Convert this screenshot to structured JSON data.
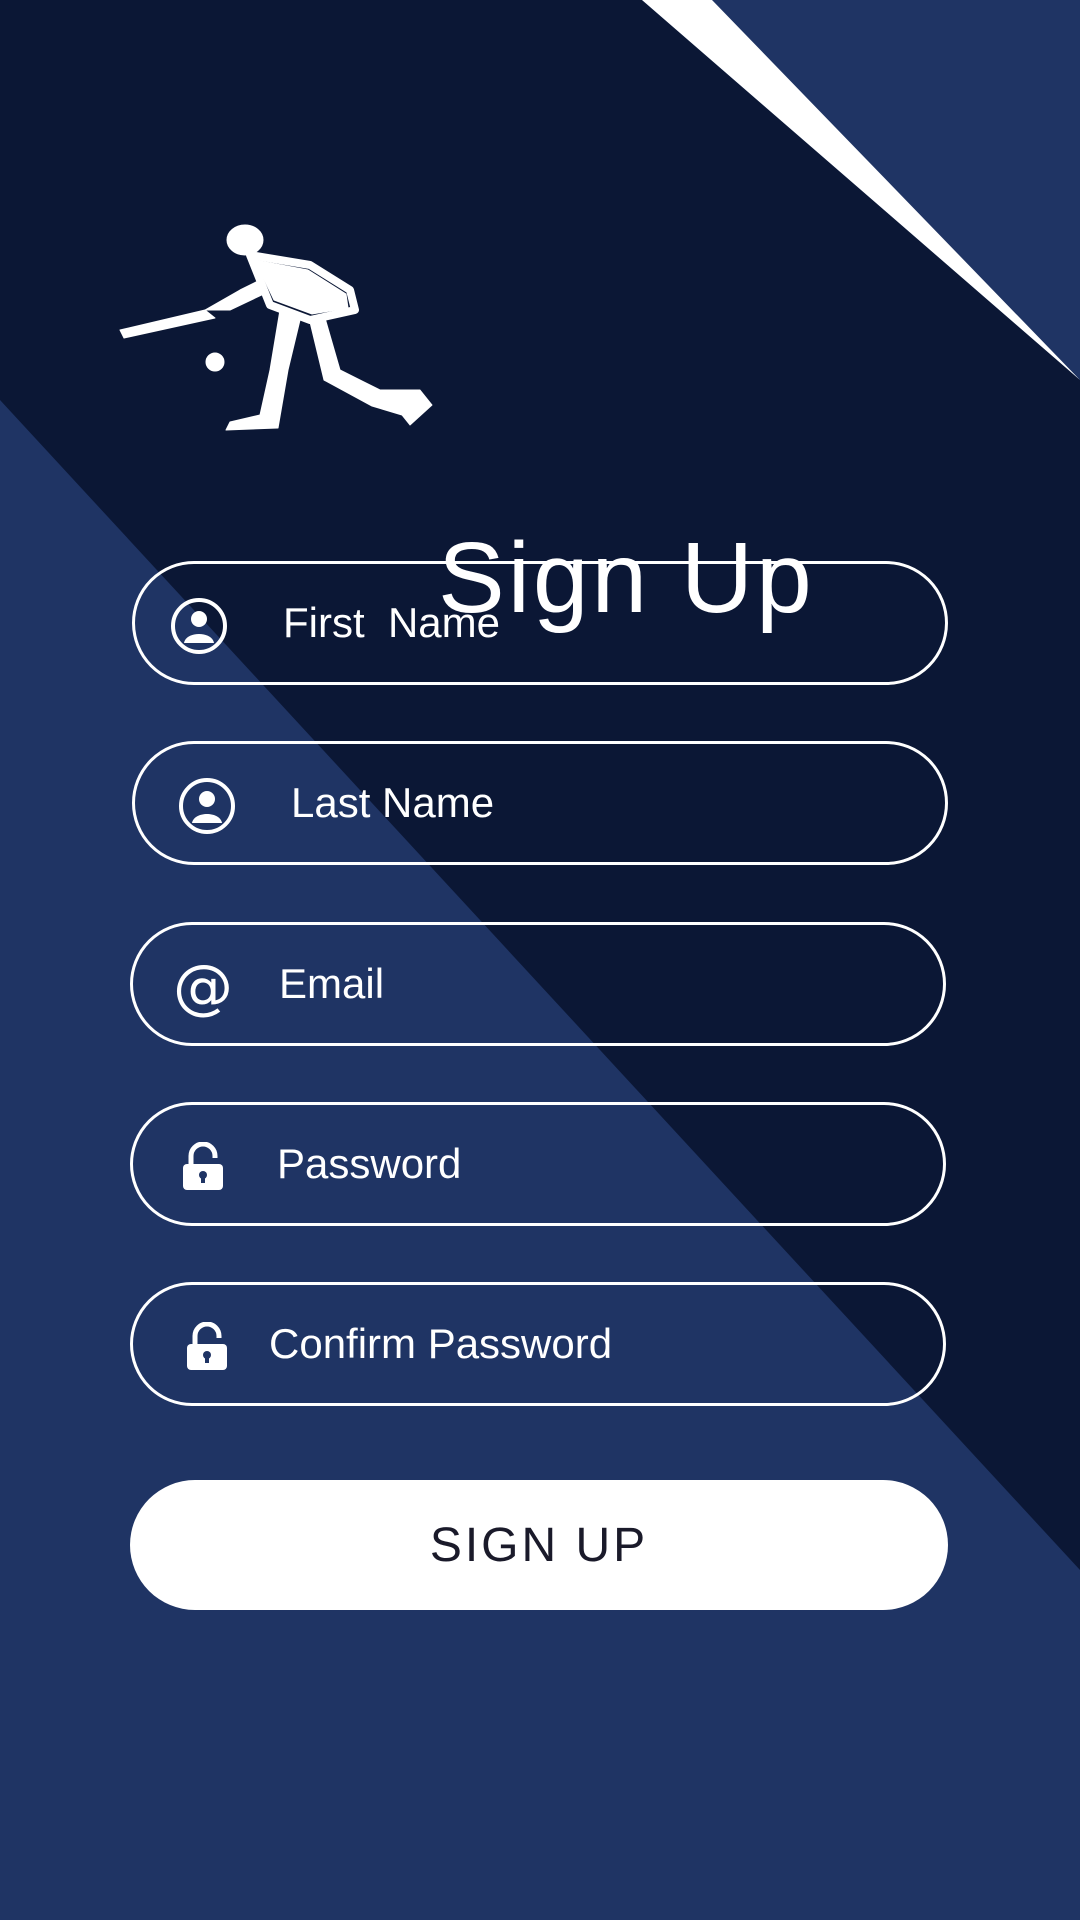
{
  "colors": {
    "dark_navy": "#0b1735",
    "mid_navy": "#1f3464",
    "white": "#ffffff"
  },
  "header": {
    "title": "Sign Up",
    "logo_icon": "cricket-batsman-icon"
  },
  "form": {
    "fields": [
      {
        "label": "First  Name",
        "icon": "user-icon"
      },
      {
        "label": "Last Name",
        "icon": "user-icon"
      },
      {
        "label": "Email",
        "icon": "at-icon"
      },
      {
        "label": "Password",
        "icon": "lock-open-icon"
      },
      {
        "label": "Confirm Password",
        "icon": "lock-open-icon"
      }
    ],
    "submit_label": "SIGN UP"
  },
  "icons": {
    "at_glyph": "@"
  }
}
